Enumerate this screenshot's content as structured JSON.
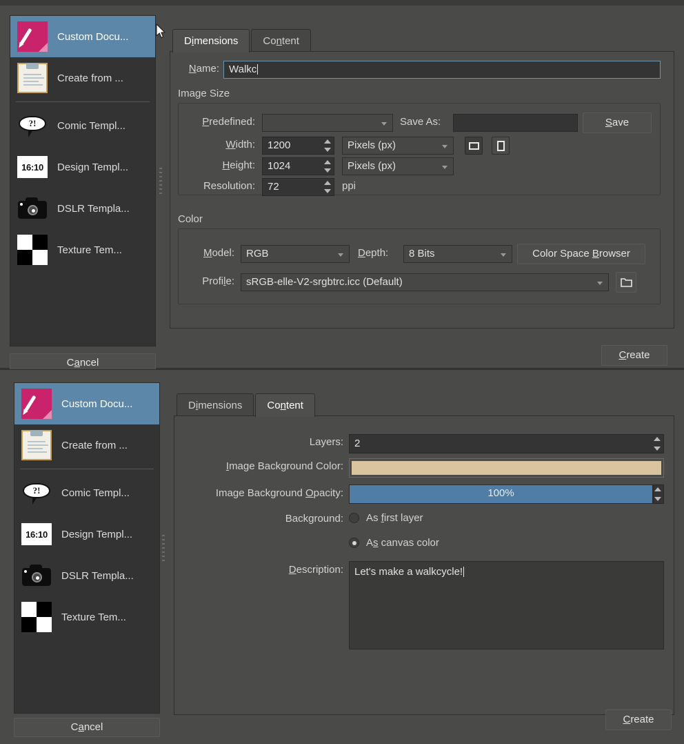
{
  "app": {
    "accent_selected": "#5c87a8",
    "bg_window": "#4a4a48",
    "bg_panel": "#4b4b49",
    "bg_list": "#333333",
    "bg_field": "#343434",
    "text_primary": "#d6d6d6"
  },
  "templates": [
    {
      "id": "custom-document",
      "label": "Custom Docu...",
      "icon": "custom-document-icon",
      "selected": true
    },
    {
      "id": "create-from-clipboard",
      "label": "Create from ...",
      "icon": "clipboard-icon",
      "selected": false
    },
    {
      "id": "comic-templates",
      "label": "Comic Templ...",
      "icon": "comic-bubble-icon",
      "selected": false
    },
    {
      "id": "design-templates",
      "label": "Design Templ...",
      "icon": "aspect-ratio-icon",
      "icon_text": "16:10",
      "selected": false
    },
    {
      "id": "dslr-templates",
      "label": "DSLR Templa...",
      "icon": "camera-icon",
      "selected": false
    },
    {
      "id": "texture-templates",
      "label": "Texture Tem...",
      "icon": "checkerboard-icon",
      "selected": false
    }
  ],
  "dialog_dimensions": {
    "tabs": [
      {
        "id": "dimensions",
        "label": "Dimensions",
        "mnemonic": "i",
        "active": true
      },
      {
        "id": "content",
        "label": "Content",
        "mnemonic": "n",
        "active": false
      }
    ],
    "name": {
      "label": "Name:",
      "mnemonic": "N",
      "value": "Walkc",
      "placeholder": ""
    },
    "image_size": {
      "group_label": "Image Size",
      "predefined": {
        "label": "Predefined:",
        "mnemonic": "P",
        "value": ""
      },
      "save_as": {
        "label": "Save As:",
        "value": "",
        "placeholder": ""
      },
      "save_button": {
        "label": "Save",
        "mnemonic": "S"
      },
      "width": {
        "label": "Width:",
        "mnemonic": "W",
        "value": "1200",
        "unit": "Pixels (px)"
      },
      "height": {
        "label": "Height:",
        "mnemonic": "H",
        "value": "1024",
        "unit": "Pixels (px)"
      },
      "resolution": {
        "label": "Resolution:",
        "value": "72",
        "unit": "ppi"
      },
      "orientation": {
        "landscape": {
          "name": "landscape-orientation-button",
          "selected": true
        },
        "portrait": {
          "name": "portrait-orientation-button",
          "selected": false
        }
      }
    },
    "color": {
      "group_label": "Color",
      "model": {
        "label": "Model:",
        "mnemonic": "M",
        "value": "RGB"
      },
      "depth": {
        "label": "Depth:",
        "mnemonic": "D",
        "value": "8 Bits"
      },
      "color_space_browser": {
        "label": "Color Space Browser",
        "mnemonic": "B"
      },
      "profile": {
        "label": "Profile:",
        "mnemonic": "l",
        "value": "sRGB-elle-V2-srgbtrc.icc (Default)"
      },
      "profile_folder_icon": "folder-icon"
    },
    "buttons": {
      "cancel": {
        "label": "Cancel",
        "mnemonic": "a"
      },
      "create": {
        "label": "Create",
        "mnemonic": "C"
      }
    }
  },
  "dialog_content": {
    "tabs": [
      {
        "id": "dimensions",
        "label": "Dimensions",
        "mnemonic": "i",
        "active": false
      },
      {
        "id": "content",
        "label": "Content",
        "mnemonic": "n",
        "active": true
      }
    ],
    "layers": {
      "label": "Layers:",
      "value": "2"
    },
    "background_color": {
      "label": "Image Background Color:",
      "mnemonic": "I",
      "swatch_hex": "#d9c4a0"
    },
    "background_opacity": {
      "label": "Image Background Opacity:",
      "mnemonic": "O",
      "value": "100%",
      "percent": 100,
      "fill_hex": "#4f7da6"
    },
    "background": {
      "label": "Background:",
      "options": [
        {
          "id": "as-first-layer",
          "label": "As first layer",
          "mnemonic": "f",
          "selected": false
        },
        {
          "id": "as-canvas-color",
          "label": "As canvas color",
          "mnemonic": "s",
          "selected": true
        }
      ]
    },
    "description": {
      "label": "Description:",
      "mnemonic": "D",
      "value": "Let's make a walkcycle!"
    },
    "buttons": {
      "cancel": {
        "label": "Cancel",
        "mnemonic": "a"
      },
      "create": {
        "label": "Create",
        "mnemonic": "C"
      }
    }
  }
}
